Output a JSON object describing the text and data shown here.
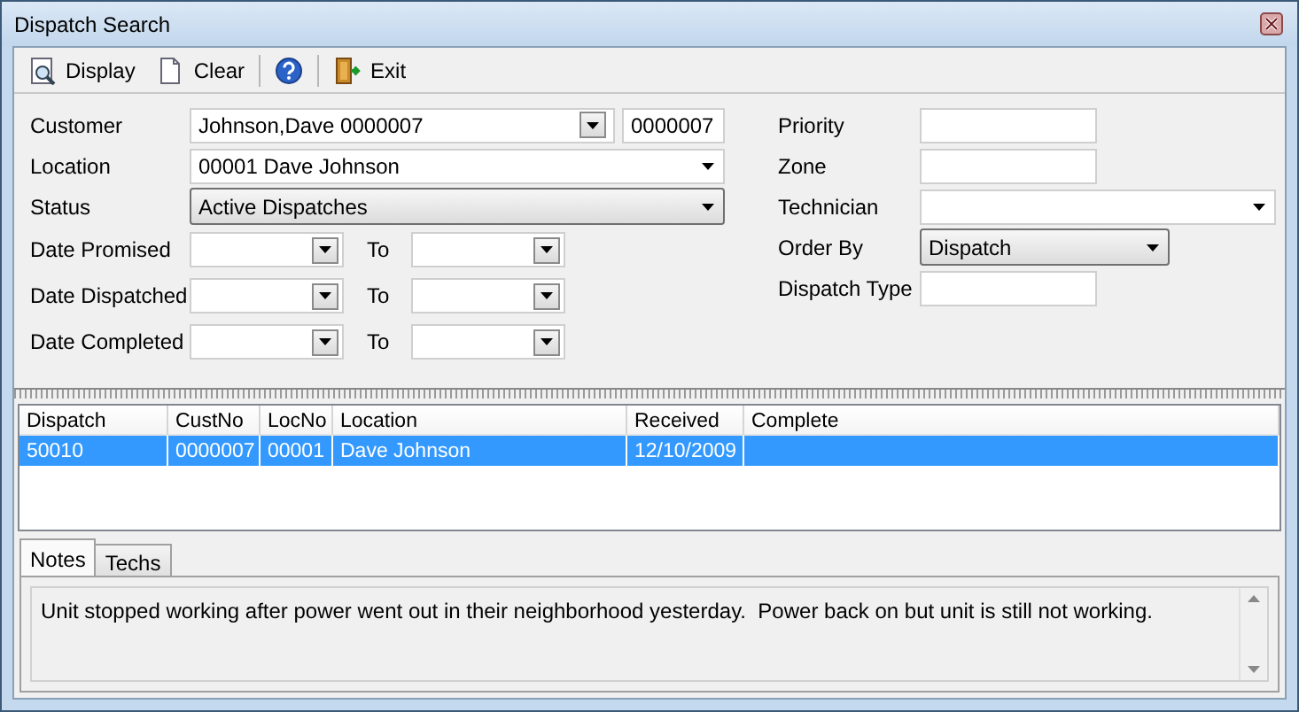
{
  "window": {
    "title": "Dispatch Search"
  },
  "toolbar": [
    {
      "kind": "button",
      "label": "Display"
    },
    {
      "kind": "button",
      "label": "Clear"
    },
    {
      "kind": "separator"
    },
    {
      "kind": "icon-button"
    },
    {
      "kind": "separator"
    },
    {
      "kind": "button",
      "label": "Exit"
    }
  ],
  "left_fields": [
    {
      "kind": "customer",
      "label": "Customer",
      "value": "Johnson,Dave 0000007",
      "code": "0000007"
    },
    {
      "kind": "combo",
      "label": "Location",
      "value": "00001 Dave Johnson"
    },
    {
      "kind": "dropdown",
      "label": "Status",
      "value": "Active Dispatches"
    },
    {
      "kind": "daterange",
      "label": "Date Promised",
      "to_label": "To"
    },
    {
      "kind": "daterange",
      "label": "Date Dispatched",
      "to_label": "To"
    },
    {
      "kind": "daterange",
      "label": "Date Completed",
      "to_label": "To"
    }
  ],
  "right_fields": [
    {
      "kind": "text",
      "label": "Priority"
    },
    {
      "kind": "text",
      "label": "Zone"
    },
    {
      "kind": "combo",
      "label": "Technician"
    },
    {
      "kind": "dropdown",
      "label": "Order By",
      "value": "Dispatch"
    },
    {
      "kind": "text",
      "label": "Dispatch Type"
    }
  ],
  "table": {
    "columns": [
      "Dispatch",
      "CustNo",
      "LocNo",
      "Location",
      "Received",
      "Complete"
    ],
    "rows": [
      {
        "selected": true,
        "cells": [
          "50010",
          "0000007",
          "00001",
          "Dave Johnson",
          "12/10/2009",
          ""
        ]
      }
    ]
  },
  "tabs": [
    {
      "label": "Notes",
      "selected": true
    },
    {
      "label": "Techs",
      "selected": false
    }
  ],
  "notes": "Unit stopped working after power went out in their neighborhood yesterday.  Power back on but unit is still not working."
}
